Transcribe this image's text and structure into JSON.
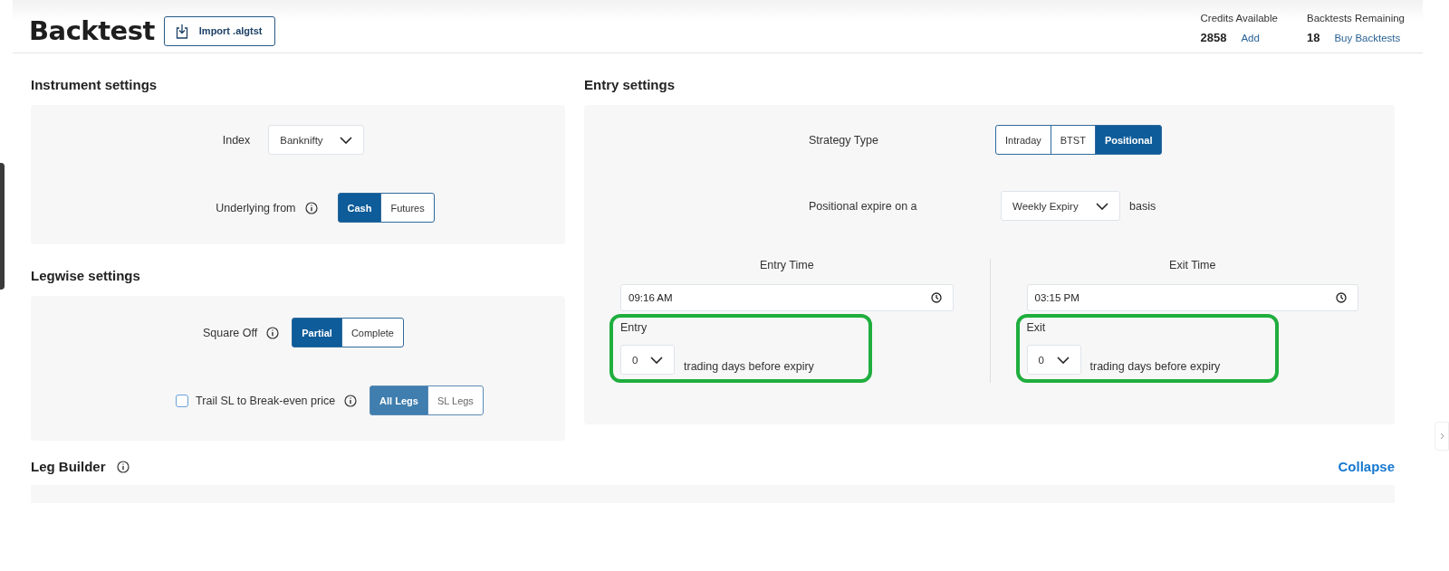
{
  "header": {
    "title": "Backtest",
    "import_button": "Import .algtst",
    "stats": [
      {
        "label": "Credits Available",
        "value": "2858",
        "link": "Add"
      },
      {
        "label": "Backtests Remaining",
        "value": "18",
        "link": "Buy Backtests"
      }
    ]
  },
  "instrument_settings": {
    "title": "Instrument settings",
    "index": {
      "label": "Index",
      "value": "Banknifty"
    },
    "underlying": {
      "label": "Underlying from",
      "options": [
        {
          "label": "Cash",
          "selected": true
        },
        {
          "label": "Futures",
          "selected": false
        }
      ]
    }
  },
  "legwise_settings": {
    "title": "Legwise settings",
    "square_off": {
      "label": "Square Off",
      "options": [
        {
          "label": "Partial",
          "selected": true
        },
        {
          "label": "Complete",
          "selected": false
        }
      ]
    },
    "trail_sl": {
      "label": "Trail SL to Break-even price",
      "checked": false,
      "options": [
        {
          "label": "All Legs",
          "selected": true
        },
        {
          "label": "SL Legs",
          "selected": false
        }
      ]
    }
  },
  "entry_settings": {
    "title": "Entry settings",
    "strategy_type": {
      "label": "Strategy Type",
      "options": [
        {
          "label": "Intraday",
          "selected": false
        },
        {
          "label": "BTST",
          "selected": false
        },
        {
          "label": "Positional",
          "selected": true
        }
      ]
    },
    "positional_expiry": {
      "label": "Positional expire on a",
      "value": "Weekly Expiry",
      "suffix": "basis"
    },
    "times": [
      {
        "label": "Entry Time",
        "value": "09:16 AM",
        "days_label": "Entry",
        "days_value": "0",
        "days_suffix": "trading days before expiry"
      },
      {
        "label": "Exit Time",
        "value": "03:15 PM",
        "days_label": "Exit",
        "days_value": "0",
        "days_suffix": "trading days before expiry"
      }
    ]
  },
  "leg_builder": {
    "title": "Leg Builder",
    "collapse": "Collapse"
  }
}
